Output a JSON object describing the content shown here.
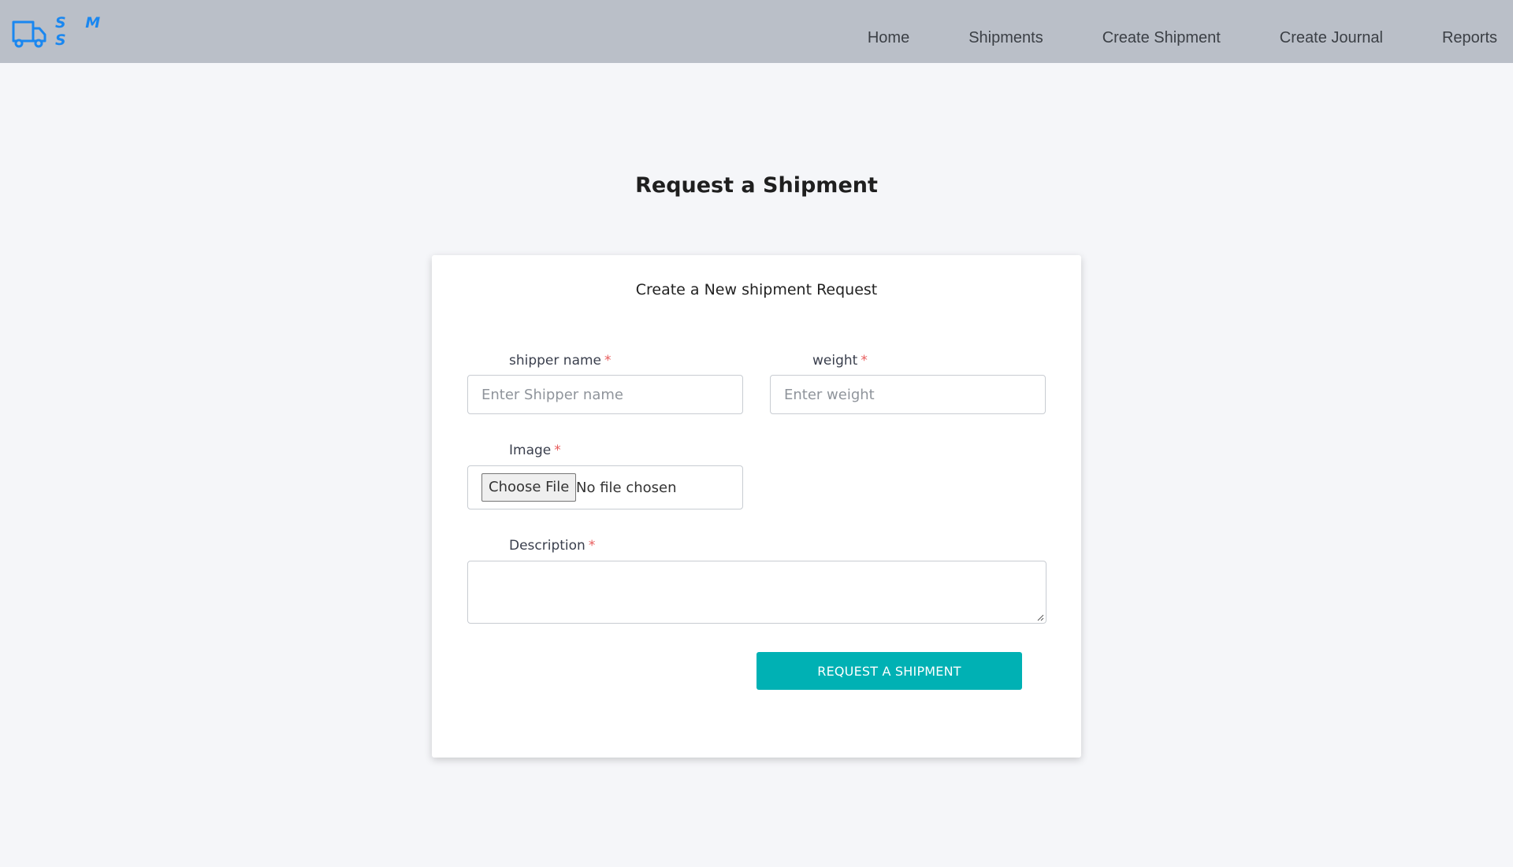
{
  "app": {
    "logo_text": "S M S",
    "logo_icon": "truck-icon",
    "brand_color": "#1a87f0"
  },
  "nav": {
    "items": [
      "Home",
      "Shipments",
      "Create Shipment",
      "Create Journal",
      "Reports"
    ]
  },
  "page": {
    "title": "Request a Shipment"
  },
  "form": {
    "title": "Create a New shipment Request",
    "required_marker": "*",
    "shipper_name": {
      "label": "shipper name",
      "placeholder": "Enter Shipper name",
      "value": ""
    },
    "weight": {
      "label": "weight",
      "placeholder": "Enter weight",
      "value": ""
    },
    "image": {
      "label": "Image",
      "button_label": "Choose File",
      "status": "No file chosen"
    },
    "description": {
      "label": "Description",
      "value": ""
    },
    "submit_label": "REQUEST A SHIPMENT",
    "submit_color": "#00b1b4"
  }
}
